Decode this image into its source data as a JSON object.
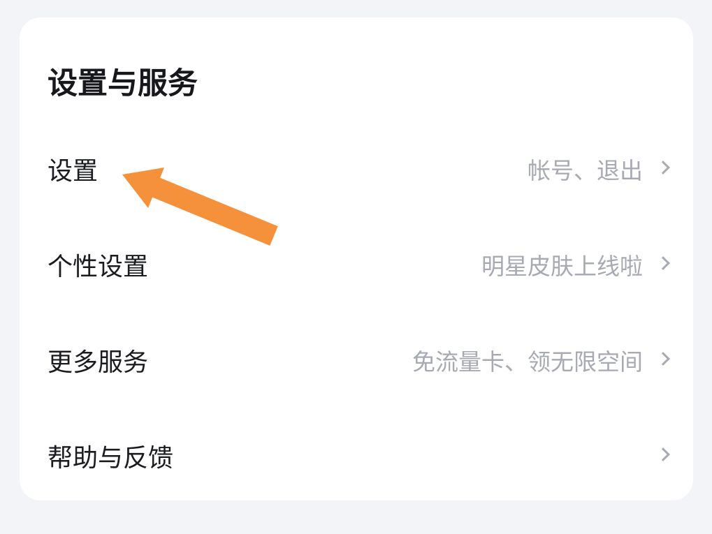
{
  "section": {
    "title": "设置与服务"
  },
  "items": [
    {
      "label": "设置",
      "hint": "帐号、退出"
    },
    {
      "label": "个性设置",
      "hint": "明星皮肤上线啦"
    },
    {
      "label": "更多服务",
      "hint": "免流量卡、领无限空间"
    },
    {
      "label": "帮助与反馈",
      "hint": ""
    }
  ],
  "colors": {
    "background": "#f3f4f8",
    "card": "#ffffff",
    "title_text": "#17181c",
    "label_text": "#1b1c20",
    "hint_text": "#a7aab3",
    "annotation_arrow": "#f5913b"
  },
  "icons": {
    "chevron": "chevron-right-icon",
    "annotation": "orange-arrow-annotation"
  }
}
